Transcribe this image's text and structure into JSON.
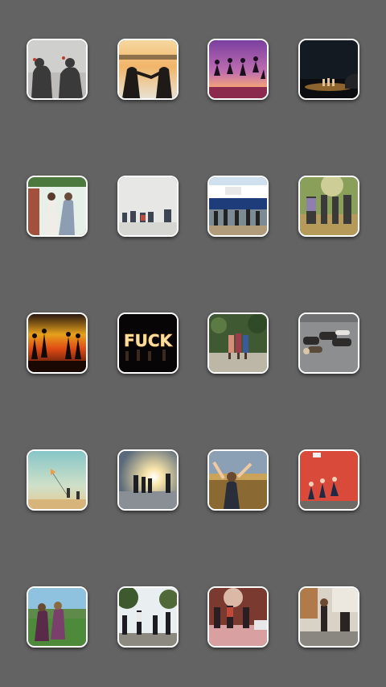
{
  "screen": {
    "background": "#636363",
    "tile_border": "#ffffff"
  },
  "gallery": {
    "rows": [
      {
        "tiles": [
          {
            "name": "photo-shadows-on-wall"
          },
          {
            "name": "photo-sunset-friends-holding-hands"
          },
          {
            "name": "photo-purple-sky-jumping-silhouettes"
          },
          {
            "name": "photo-night-beach-group"
          }
        ]
      },
      {
        "tiles": [
          {
            "name": "photo-friends-hug-brick-wall"
          },
          {
            "name": "photo-friends-sitting-pale-horizon"
          },
          {
            "name": "photo-ship-and-friends-dock"
          },
          {
            "name": "photo-friends-walking-forest"
          }
        ]
      },
      {
        "tiles": [
          {
            "name": "photo-sunset-silhouettes-beach"
          },
          {
            "name": "photo-sparkler-lettering-night",
            "lettering": "FUCK"
          },
          {
            "name": "photo-girls-posing-park"
          },
          {
            "name": "photo-friends-lying-on-ground"
          }
        ]
      },
      {
        "tiles": [
          {
            "name": "photo-beach-kite"
          },
          {
            "name": "photo-sun-flare-beach-group"
          },
          {
            "name": "photo-girl-arms-raised-hill"
          },
          {
            "name": "photo-red-wall-jumping"
          }
        ]
      },
      {
        "tiles": [
          {
            "name": "photo-two-girls-field"
          },
          {
            "name": "photo-friends-dancing-outdoors"
          },
          {
            "name": "photo-friends-street-party"
          },
          {
            "name": "photo-friends-cafe"
          }
        ]
      }
    ]
  }
}
